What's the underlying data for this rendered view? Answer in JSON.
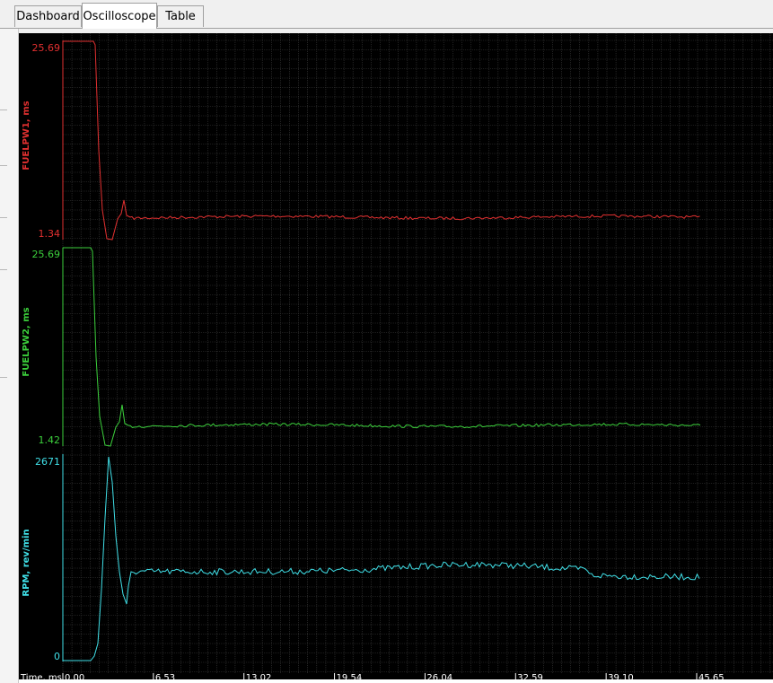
{
  "tabs": [
    {
      "label": "Dashboard",
      "active": false
    },
    {
      "label": "Oscilloscope",
      "active": true
    },
    {
      "label": "Table",
      "active": false
    }
  ],
  "channels": [
    {
      "name": "FUELPW1, ms",
      "max": "25.69",
      "min": "1.34",
      "color": "#e23030"
    },
    {
      "name": "FUELPW2, ms",
      "max": "25.69",
      "min": "1.42",
      "color": "#3cd03c"
    },
    {
      "name": "RPM, rev/min",
      "max": "2671",
      "min": "0",
      "color": "#40e0e8"
    }
  ],
  "time_axis": {
    "label": "Time, ms",
    "ticks": [
      "0.00",
      "6.53",
      "13.02",
      "19.54",
      "26.04",
      "32.59",
      "39.10",
      "45.65"
    ]
  },
  "colors": {
    "background": "#000000",
    "grid": "#3a3a3a"
  }
}
